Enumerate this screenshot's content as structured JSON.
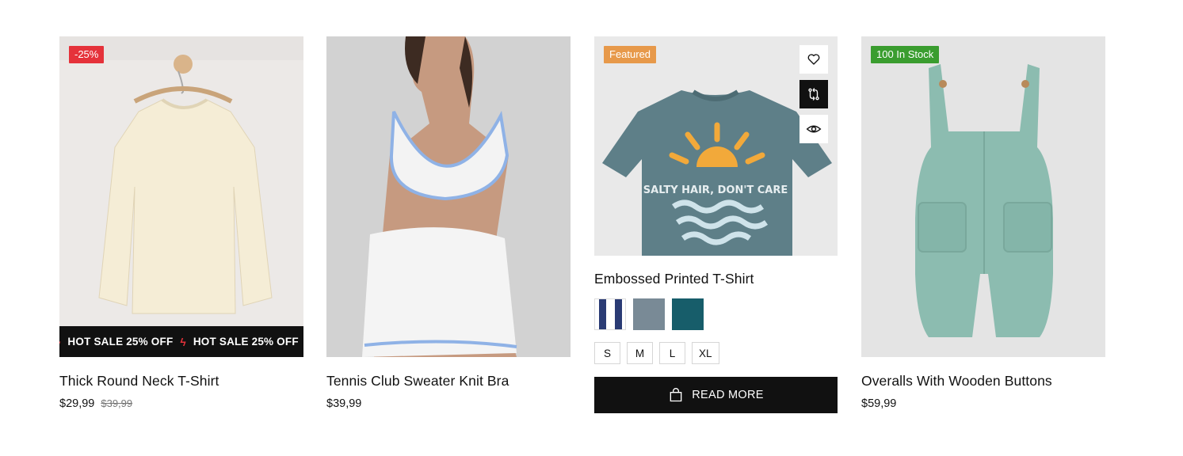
{
  "products": [
    {
      "badge": "-25%",
      "marquee": [
        "HOT SALE 25% OFF",
        "HOT SALE 25% OFF"
      ],
      "title": "Thick Round Neck T-Shirt",
      "price": "$29,99",
      "old_price": "$39,99"
    },
    {
      "title": "Tennis Club Sweater Knit Bra",
      "price": "$39,99"
    },
    {
      "badge": "Featured",
      "actions": [
        "heart-icon",
        "compare-icon",
        "eye-icon"
      ],
      "title": "Embossed Printed T-Shirt",
      "swatch_colors": [
        "#2a3b74",
        "#798a96",
        "#175d6a"
      ],
      "sizes": [
        "S",
        "M",
        "L",
        "XL"
      ],
      "button": "READ MORE"
    },
    {
      "badge": "100 In Stock",
      "title": "Overalls With Wooden Buttons",
      "price": "$59,99"
    }
  ],
  "colors": {
    "sale": "#e5323a",
    "featured": "#e7994a",
    "stock": "#3a9d2f",
    "dark": "#111111"
  }
}
